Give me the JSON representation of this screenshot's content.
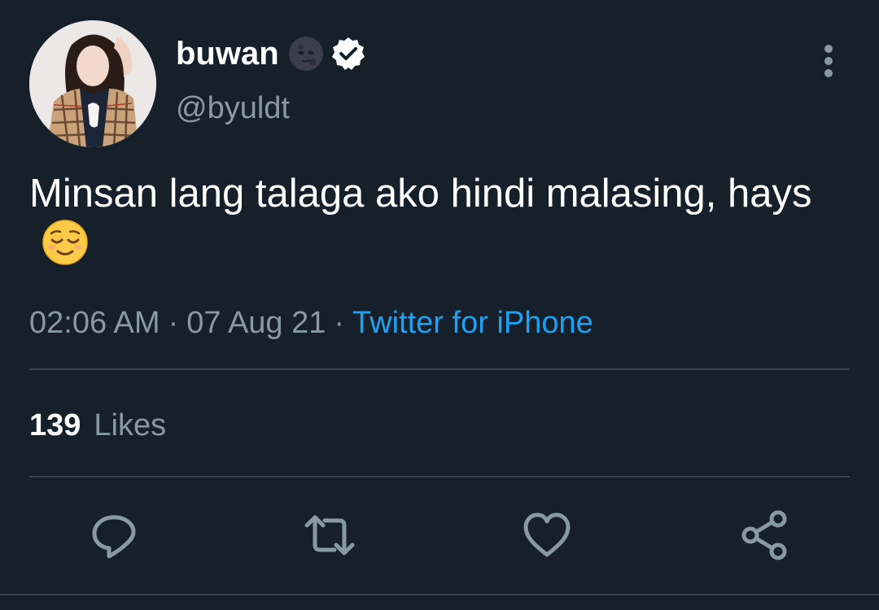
{
  "user": {
    "display_name": "buwan",
    "handle": "@byuldt",
    "verified": true,
    "name_emoji": "new-moon-face"
  },
  "tweet": {
    "text": "Minsan lang talaga ako hindi malasing, hays",
    "emoji": "relieved-face",
    "time": "02:06 AM",
    "date": "07 Aug 21",
    "separator": "·",
    "source": "Twitter for iPhone"
  },
  "stats": {
    "likes_count": "139",
    "likes_label": "Likes"
  },
  "actions": [
    "reply-icon",
    "retweet-icon",
    "like-icon",
    "share-icon"
  ],
  "colors": {
    "background": "#15202b",
    "text": "#ffffff",
    "secondary": "#8899a6",
    "accent": "#1da1f2",
    "divider": "#38444d"
  }
}
